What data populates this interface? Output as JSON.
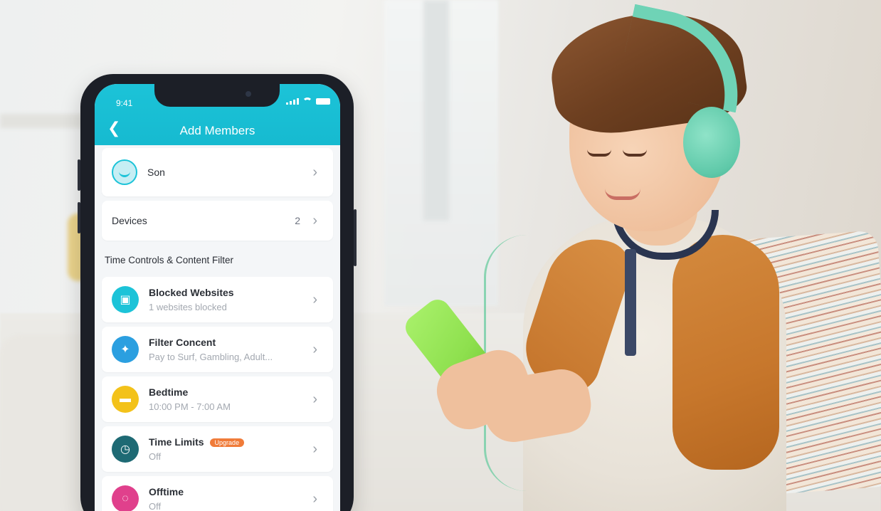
{
  "status_bar": {
    "time": "9:41"
  },
  "app_bar": {
    "back_icon": "chevron-left-icon",
    "title": "Add Members"
  },
  "member": {
    "name": "Son",
    "avatar_icon": "kid-face-icon"
  },
  "devices": {
    "label": "Devices",
    "count": "2"
  },
  "section_title": "Time Controls & Content Filter",
  "items": [
    {
      "title": "Blocked Websites",
      "subtitle": "1 websites blocked",
      "icon": "blocked-websites-icon",
      "color": "#1cc3d8",
      "glyph": "▣"
    },
    {
      "title": "Filter Concent",
      "subtitle": "Pay to Surf, Gambling, Adult...",
      "icon": "filter-content-icon",
      "color": "#2b9fe0",
      "glyph": "✦"
    },
    {
      "title": "Bedtime",
      "subtitle": "10:00 PM - 7:00 AM",
      "icon": "bed-icon",
      "color": "#f3c21a",
      "glyph": "▬"
    },
    {
      "title": "Time Limits",
      "subtitle": "Off",
      "icon": "clock-icon",
      "color": "#1e6a74",
      "glyph": "◷",
      "badge": "Upgrade"
    },
    {
      "title": "Offtime",
      "subtitle": "Off",
      "icon": "offtime-icon",
      "color": "#e0408c",
      "glyph": "◌"
    }
  ],
  "colors": {
    "accent": "#1cc3d8",
    "badge": "#f07b39"
  }
}
